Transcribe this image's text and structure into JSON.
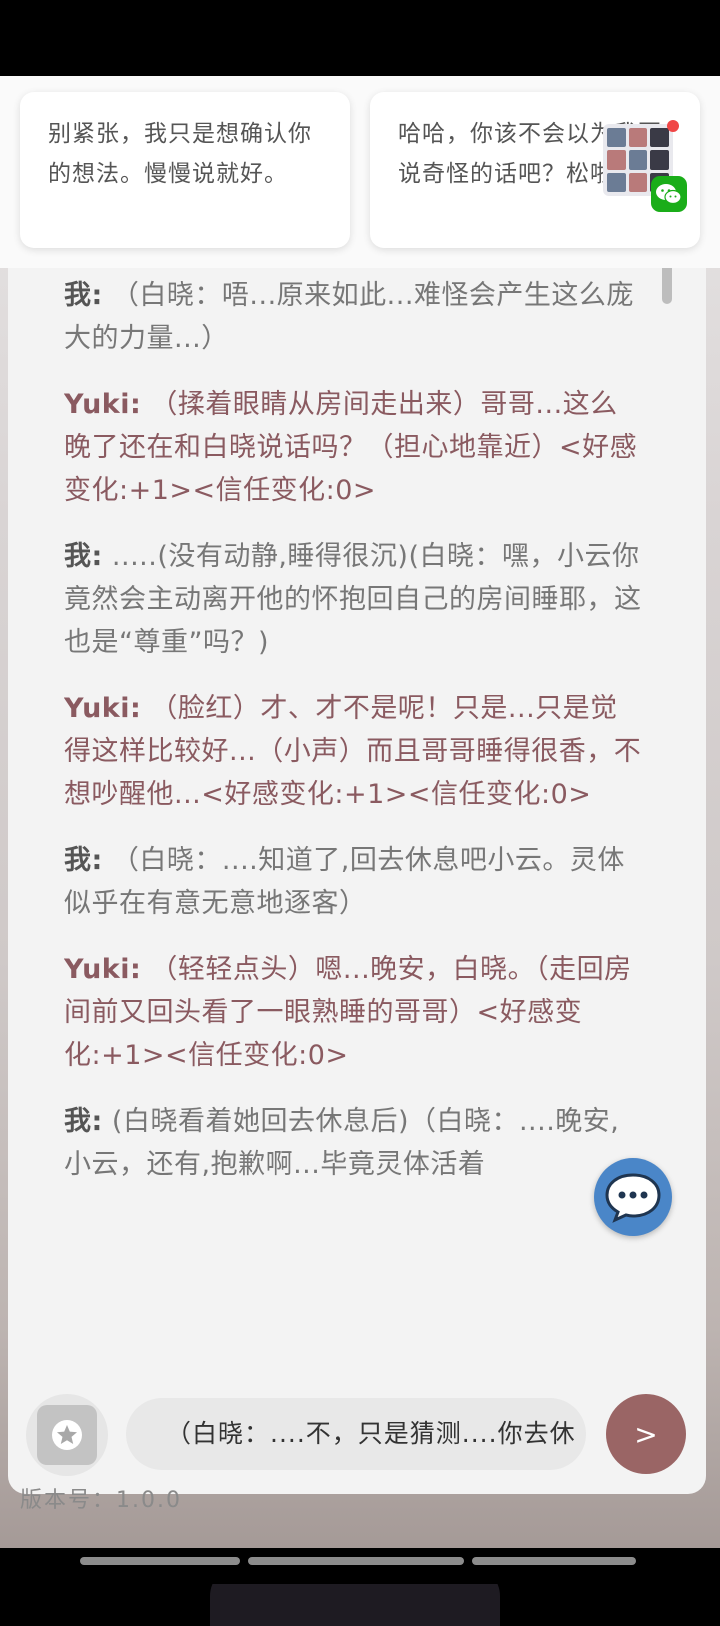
{
  "suggestions": {
    "left": "别紧张，我只是想确认你的想法。慢慢说就好。",
    "right": "哈哈，你该不会以为我要说奇怪的话吧？松啦。"
  },
  "ad": {
    "icon": "wechat-icon"
  },
  "messages": [
    {
      "speaker": "我:",
      "role": "me",
      "text": "（白晓：唔...原来如此...难怪会产生这么庞大的力量...）"
    },
    {
      "speaker": "Yuki:",
      "role": "yuki",
      "text": "（揉着眼睛从房间走出来）哥哥...这么晚了还在和白晓说话吗？（担心地靠近）<好感变化:+1><信任变化:0>"
    },
    {
      "speaker": "我:",
      "role": "me",
      "text": ".....(没有动静,睡得很沉)(白晓：嘿，小云你竟然会主动离开他的怀抱回自己的房间睡耶，这也是“尊重”吗？)"
    },
    {
      "speaker": "Yuki:",
      "role": "yuki",
      "text": "（脸红）才、才不是呢！只是...只是觉得这样比较好...（小声）而且哥哥睡得很香，不想吵醒他...<好感变化:+1><信任变化:0>"
    },
    {
      "speaker": "我:",
      "role": "me",
      "text": "（白晓：....知道了,回去休息吧小云。灵体似乎在有意无意地逐客）"
    },
    {
      "speaker": "Yuki:",
      "role": "yuki",
      "text": "（轻轻点头）嗯...晚安，白晓。（走回房间前又回头看了一眼熟睡的哥哥）<好感变化:+1><信任变化:0>"
    },
    {
      "speaker": "我:",
      "role": "me",
      "text": "(白晓看着她回去休息后)（白晓：....晚安,小云，还有,抱歉啊...毕竟灵体活着"
    }
  ],
  "input": {
    "value": "（白晓：....不，只是猜测....你去休"
  },
  "send": {
    "label": ">"
  },
  "version": {
    "label": "版本号：1.0.0"
  },
  "colors": {
    "accent": "#9a6565",
    "yuki_text": "#8a5a60",
    "chat_bubble": "#4a86c8"
  }
}
